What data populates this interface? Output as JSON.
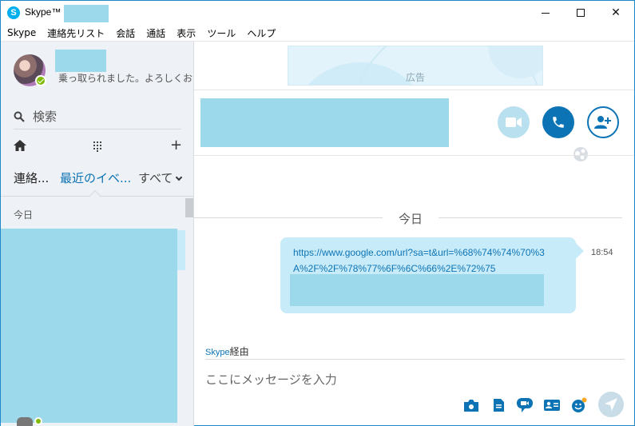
{
  "window": {
    "title": "Skype™ -",
    "app_icon_letter": "S",
    "controls": {
      "minimize": "",
      "maximize": "",
      "close": "✕"
    }
  },
  "menu": [
    "Skype",
    "連絡先リスト",
    "会話",
    "通話",
    "表示",
    "ツール",
    "ヘルプ"
  ],
  "profile": {
    "mood": "乗っ取られました。よろしくお...",
    "status_color": "#7fba00"
  },
  "sidebar": {
    "search_label": "検索",
    "icons": [
      "home-icon",
      "dialpad-icon",
      "plus-icon"
    ],
    "plus_glyph": "+",
    "tabs": {
      "contacts": "連絡...",
      "recent": "最近のイベ...",
      "all": "すべて"
    },
    "section_today": "今日"
  },
  "ad": {
    "label": "広告"
  },
  "conversation": {
    "call_buttons": [
      "video-call-icon",
      "voice-call-icon",
      "add-people-icon"
    ],
    "date_divider": "今日",
    "message": {
      "text": "https://www.google.com/url?sa=t&url=%68%74%74%70%3A%2F%2F%78%77%6F%6C%66%2E%72%75",
      "time": "18:54"
    },
    "via_prefix": "Skype",
    "via_suffix": "経由",
    "compose_placeholder": "ここにメッセージを入力"
  },
  "colors": {
    "accent": "#0c74b5",
    "bubble": "#c8ebf9",
    "redaction": "#9cd9ea",
    "sidebar_bg": "#eef1f5"
  }
}
